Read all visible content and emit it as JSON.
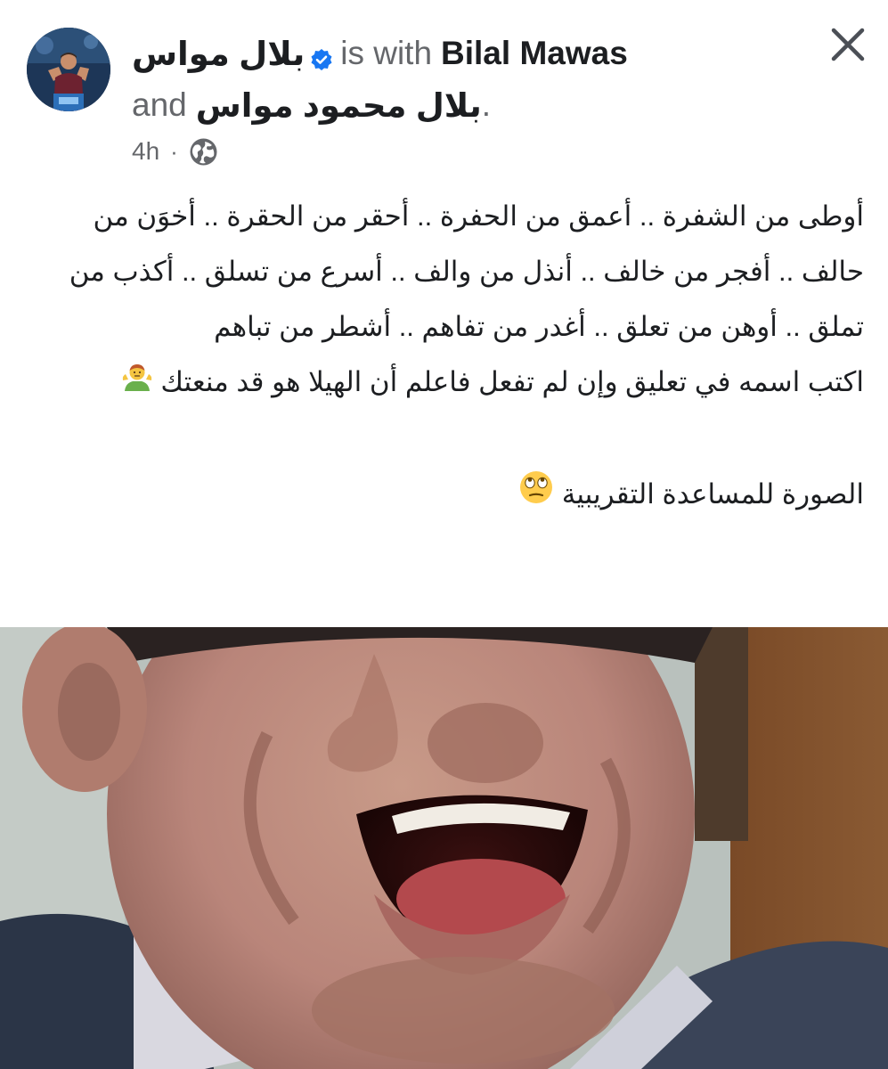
{
  "header": {
    "author_name": "بلال مواس",
    "with_text": "is with",
    "tagged_person_1": "Bilal Mawas",
    "and_text": "and",
    "tagged_person_2": "بلال محمود مواس",
    "period": ".",
    "time_ago": "4h",
    "separator": "·",
    "privacy_icon": "globe-icon",
    "verified_icon": "verified-badge-icon",
    "close_icon": "close-icon"
  },
  "post": {
    "paragraph_1": "أوطى من الشفرة .. أعمق من الحفرة .. أحقر من الحقرة .. أخوَن من حالف .. أفجر من خالف .. أنذل من والف .. أسرع من تسلق .. أكذب من تملق .. أوهن من تعلق .. أغدر من تفاهم .. أشطر من تباهم",
    "paragraph_2": "اكتب اسمه في تعليق وإن لم تفعل فاعلم أن الهيلا هو قد منعتك",
    "paragraph_2_emoji": "person-shrugging-emoji",
    "paragraph_3": "الصورة للمساعدة التقريبية",
    "paragraph_3_emoji": "face-with-rolling-eyes-emoji"
  },
  "colors": {
    "primary_text": "#1c1e21",
    "secondary_text": "#65676b",
    "verified_blue": "#1877f2"
  }
}
